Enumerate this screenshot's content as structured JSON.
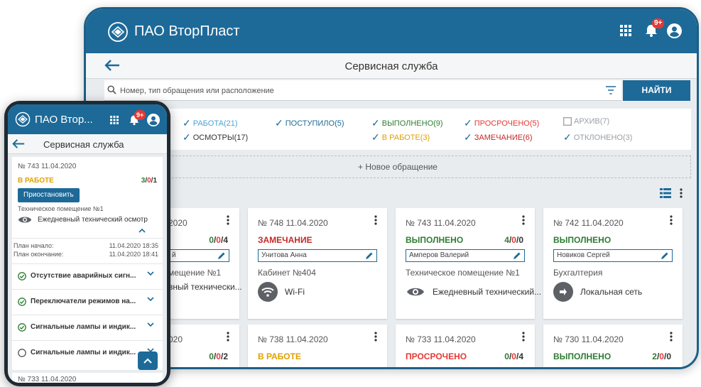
{
  "app": {
    "name": "ПАО ВторПласт",
    "name_short": "ПАО Втор...",
    "notification_count": "9+",
    "page_title": "Сервисная служба"
  },
  "search": {
    "placeholder": "Номер, тип обращения или расположение",
    "button_label": "НАЙТИ"
  },
  "filters": {
    "col1": [
      {
        "label": "РАБОТА(21)",
        "color": "#4aa3d8"
      },
      {
        "label": "ОСМОТРЫ(17)",
        "color": "#333333"
      }
    ],
    "col2": [
      {
        "label": "ПОСТУПИЛО(5)",
        "color": "#1d6a99"
      }
    ],
    "col3": [
      {
        "label": "ВЫПОЛНЕНО(9)",
        "color": "#2e7d32"
      },
      {
        "label": "В РАБОТЕ(3)",
        "color": "#e0a100"
      }
    ],
    "col4": [
      {
        "label": "ПРОСРОЧЕНО(5)",
        "color": "#e53935"
      },
      {
        "label": "ЗАМЕЧАНИЕ(6)",
        "color": "#c62828"
      }
    ],
    "col5": [
      {
        "label": "АРХИВ(7)",
        "color": "#9aa0a6"
      },
      {
        "label": "ОТКЛОНЕНО(3)",
        "color": "#9aa0a6"
      }
    ]
  },
  "new_request_label": "+ Новое обращение",
  "cards_row1": [
    {
      "head": "№ 743 11.04.2020",
      "status": "",
      "counts": [
        "0",
        "0",
        "4"
      ],
      "assignee": "",
      "location": "Техническое помещение №1",
      "type": "Ежедневный технический осмотр",
      "partial_head": "2020",
      "partial_location": "мещение №1",
      "partial_type": "вный технически..."
    },
    {
      "head": "№ 748  11.04.2020",
      "status": "ЗАМЕЧАНИЕ",
      "status_color": "#c62828",
      "counts": [],
      "assignee": "Унитова Анна",
      "location": "Кабинет №404",
      "type": "Wi-Fi"
    },
    {
      "head": "№ 743  11.04.2020",
      "status": "ВЫПОЛНЕНО",
      "status_color": "#2e7d32",
      "counts": [
        "4",
        "0",
        "0"
      ],
      "assignee": "Амперов Валерий",
      "location": "Техническое помещение №1",
      "type": "Ежедневный технический..."
    },
    {
      "head": "№ 742  11.04.2020",
      "status": "ВЫПОЛНЕНО",
      "status_color": "#2e7d32",
      "counts": [],
      "assignee": "Новиков Сергей",
      "location": "Бухгалтерия",
      "type": "Локальная сеть"
    }
  ],
  "cards_row2": [
    {
      "head": "020",
      "status": "",
      "counts": [
        "0",
        "0",
        "2"
      ]
    },
    {
      "head": "№ 738  11.04.2020",
      "status": "В РАБОТЕ",
      "status_color": "#e0a100",
      "counts": []
    },
    {
      "head": "№ 733  11.04.2020",
      "status": "ПРОСРОЧЕНО",
      "status_color": "#e53935",
      "counts": [
        "0",
        "0",
        "4"
      ]
    },
    {
      "head": "№ 730  11.04.2020",
      "status": "ВЫПОЛНЕНО",
      "status_color": "#2e7d32",
      "counts": [
        "2",
        "0",
        "0"
      ]
    }
  ],
  "mobile": {
    "card": {
      "head": "№ 743  11.04.2020",
      "status": "В РАБОТЕ",
      "counts": [
        "3",
        "0",
        "1"
      ],
      "suspend_button": "Приостановить",
      "location": "Техническое помещение №1",
      "type": "Ежедневный технический осмотр",
      "plan_start_label": "План начало:",
      "plan_start_value": "11.04.2020 18:35",
      "plan_end_label": "План окончание:",
      "plan_end_value": "11.04.2020 18:41"
    },
    "checks": [
      {
        "label": "Отсутствие аварийных сигн...",
        "done": true
      },
      {
        "label": "Переключатели режимов на...",
        "done": true
      },
      {
        "label": "Сигнальные лампы и индик...",
        "done": true
      },
      {
        "label": "Сигнальные лампы и индик...",
        "done": false
      }
    ],
    "next_card_head": "№ 733  11.04.2020"
  },
  "colors": {
    "primary": "#1d6a99",
    "ok": "#2e7d32",
    "warn": "#e0a100",
    "danger": "#e53935"
  }
}
